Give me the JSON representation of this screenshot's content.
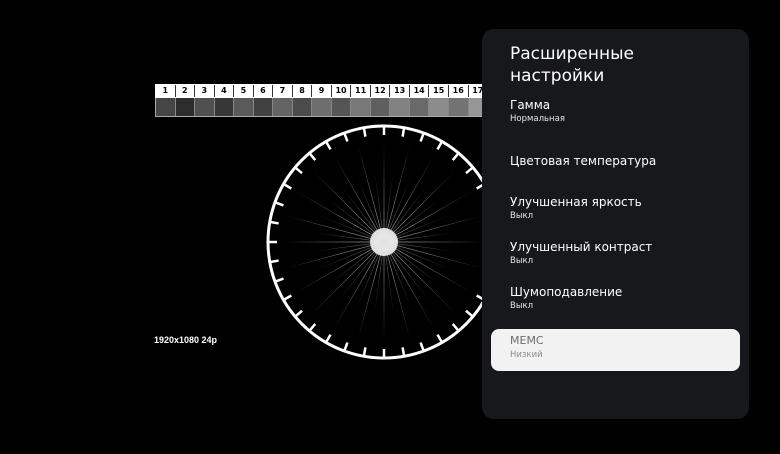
{
  "test_pattern": {
    "ruler_numbers": [
      "1",
      "2",
      "3",
      "4",
      "5",
      "6",
      "7",
      "8",
      "9",
      "10",
      "11",
      "12",
      "13",
      "14",
      "15",
      "16",
      "17"
    ],
    "resolution": "1920x1080 24p"
  },
  "panel": {
    "title": "Расширенные настройки",
    "items": [
      {
        "label": "Гамма",
        "value": "Нормальная"
      },
      {
        "label": "Цветовая температура",
        "value": ""
      },
      {
        "label": "Улучшенная яркость",
        "value": "Выкл"
      },
      {
        "label": "Улучшенный контраст",
        "value": "Выкл"
      },
      {
        "label": "Шумоподавление",
        "value": "Выкл"
      },
      {
        "label": "MEMC",
        "value": "Низкий"
      }
    ],
    "selected_index": 5
  },
  "colors": {
    "panel_bg": "#17181c",
    "selected_bg": "#f2f2f2"
  }
}
